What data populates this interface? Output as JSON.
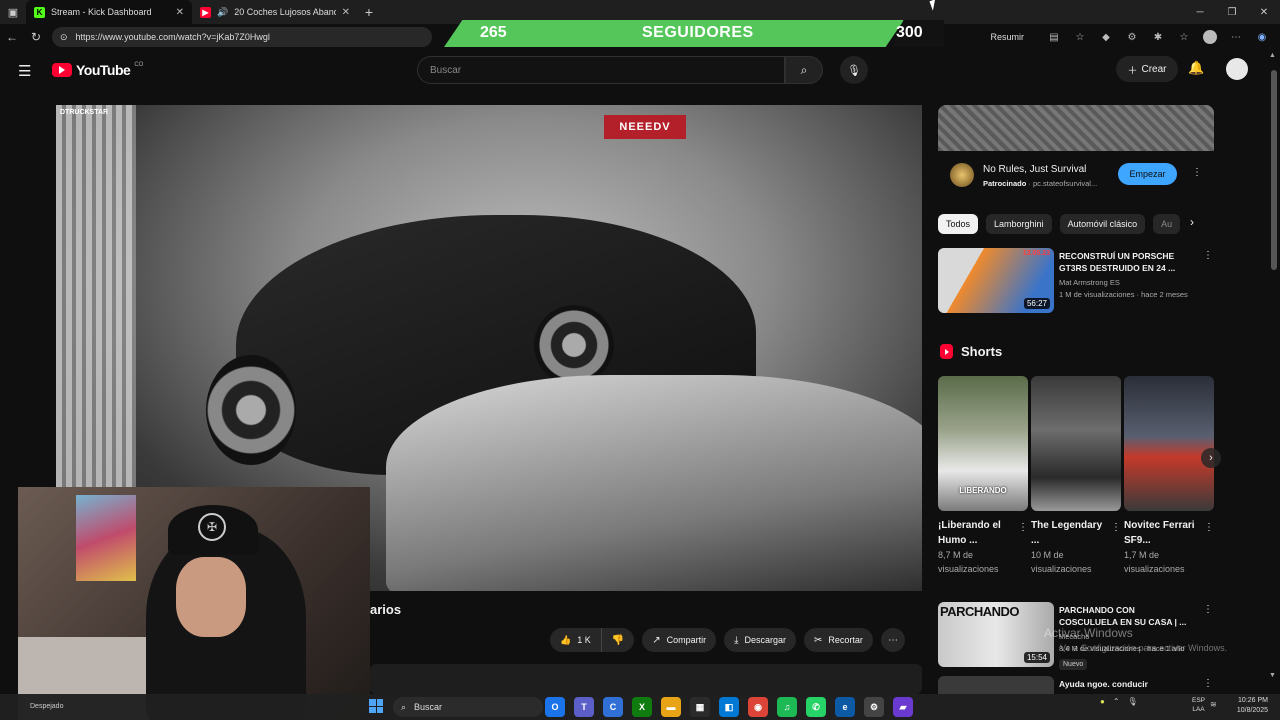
{
  "browser": {
    "tabs": [
      {
        "title": "Stream - Kick Dashboard",
        "favicon": "kick-icon",
        "color": "#53fc18",
        "active": true
      },
      {
        "title": "20 Coches Lujosos Abandon",
        "favicon": "youtube-icon",
        "color": "#ff0033",
        "active": false
      }
    ],
    "new_tab": "+",
    "url": "https://www.youtube.com/watch?v=jKab7Z0Hwgl",
    "resumir": "Resumir"
  },
  "overlay": {
    "current": "265",
    "label": "SEGUIDORES",
    "goal": "300",
    "progress_fraction": 0.883
  },
  "youtube": {
    "logo": "YouTube",
    "country": "CO",
    "search_placeholder": "Buscar",
    "create_label": "Crear"
  },
  "video": {
    "sign_text": "NEEEDV",
    "corner_tag": "DTRUCKSTAR",
    "title_fragment": "arios",
    "likes": "1 K",
    "share": "Compartir",
    "download": "Descargar",
    "clip": "Recortar"
  },
  "sidebar": {
    "ad": {
      "title": "No Rules, Just Survival",
      "sponsor_label": "Patrocinado",
      "sponsor_domain": "pc.stateofsurvival...",
      "button": "Empezar"
    },
    "chips": [
      "Todos",
      "Lamborghini",
      "Automóvil clásico",
      "Au"
    ],
    "recommendations": [
      {
        "title": "RECONSTRUÍ UN PORSCHE GT3RS DESTRUIDO EN 24 ...",
        "channel": "Mat Armstrong ES",
        "meta": "1 M de visualizaciones · hace 2 meses",
        "duration": "56:27",
        "thumb_label": "13.05.23"
      },
      {
        "title": "PARCHANDO CON COSCULUELA EN SU CASA | ...",
        "channel": "Mecacho",
        "meta": "8,4 M de visualizaciones · hace 1 año",
        "duration": "15:54",
        "badge": "Nuevo",
        "thumb_label": "PARCHANDO"
      },
      {
        "title": "Ayuda ngoe. conducir",
        "channel": "",
        "meta": "",
        "duration": "",
        "thumb_label": ""
      }
    ],
    "shorts_title": "Shorts",
    "shorts": [
      {
        "title": "¡Liberando el Humo ...",
        "views_line1": "8,7 M de",
        "views_line2": "visualizaciones",
        "caption": "LIBERANDO"
      },
      {
        "title": "The Legendary ...",
        "views_line1": "10 M de",
        "views_line2": "visualizaciones",
        "caption": ""
      },
      {
        "title": "Novitec Ferrari SF9...",
        "views_line1": "1,7 M de",
        "views_line2": "visualizaciones",
        "caption": ""
      }
    ]
  },
  "windows_watermark": {
    "line1": "Activar Windows",
    "line2": "Ve a Configuración para activar Windows."
  },
  "taskbar": {
    "weather": "Despejado",
    "search": "Buscar",
    "lang_line1": "ESP",
    "lang_line2": "LAA",
    "time": "10:26 PM",
    "date": "10/8/2025"
  },
  "colors": {
    "youtube_red": "#ff0033",
    "overlay_green": "#55c75a",
    "accent_blue": "#3ea6ff"
  }
}
